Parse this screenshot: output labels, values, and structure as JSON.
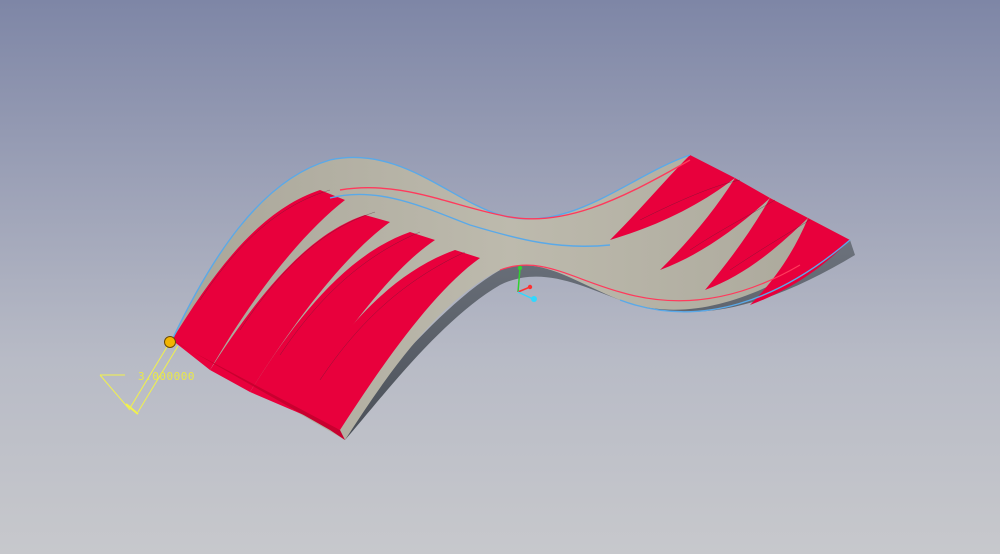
{
  "viewport": {
    "background_top": "#7e86a6",
    "background_bottom": "#c7c8cc"
  },
  "model": {
    "face_color": "#e8003c",
    "top_color": "#b4b1a4",
    "edge_color": "#5aa9e8",
    "highlight_color": "#ff3a5c",
    "side_color": "#5a6068"
  },
  "dimension": {
    "value": "3.000000",
    "color": "#f2f24a",
    "handle_color": "#f2b400"
  },
  "axis_triad": {
    "x_color": "#ff3030",
    "y_color": "#30d030",
    "z_color": "#30d8ff"
  }
}
